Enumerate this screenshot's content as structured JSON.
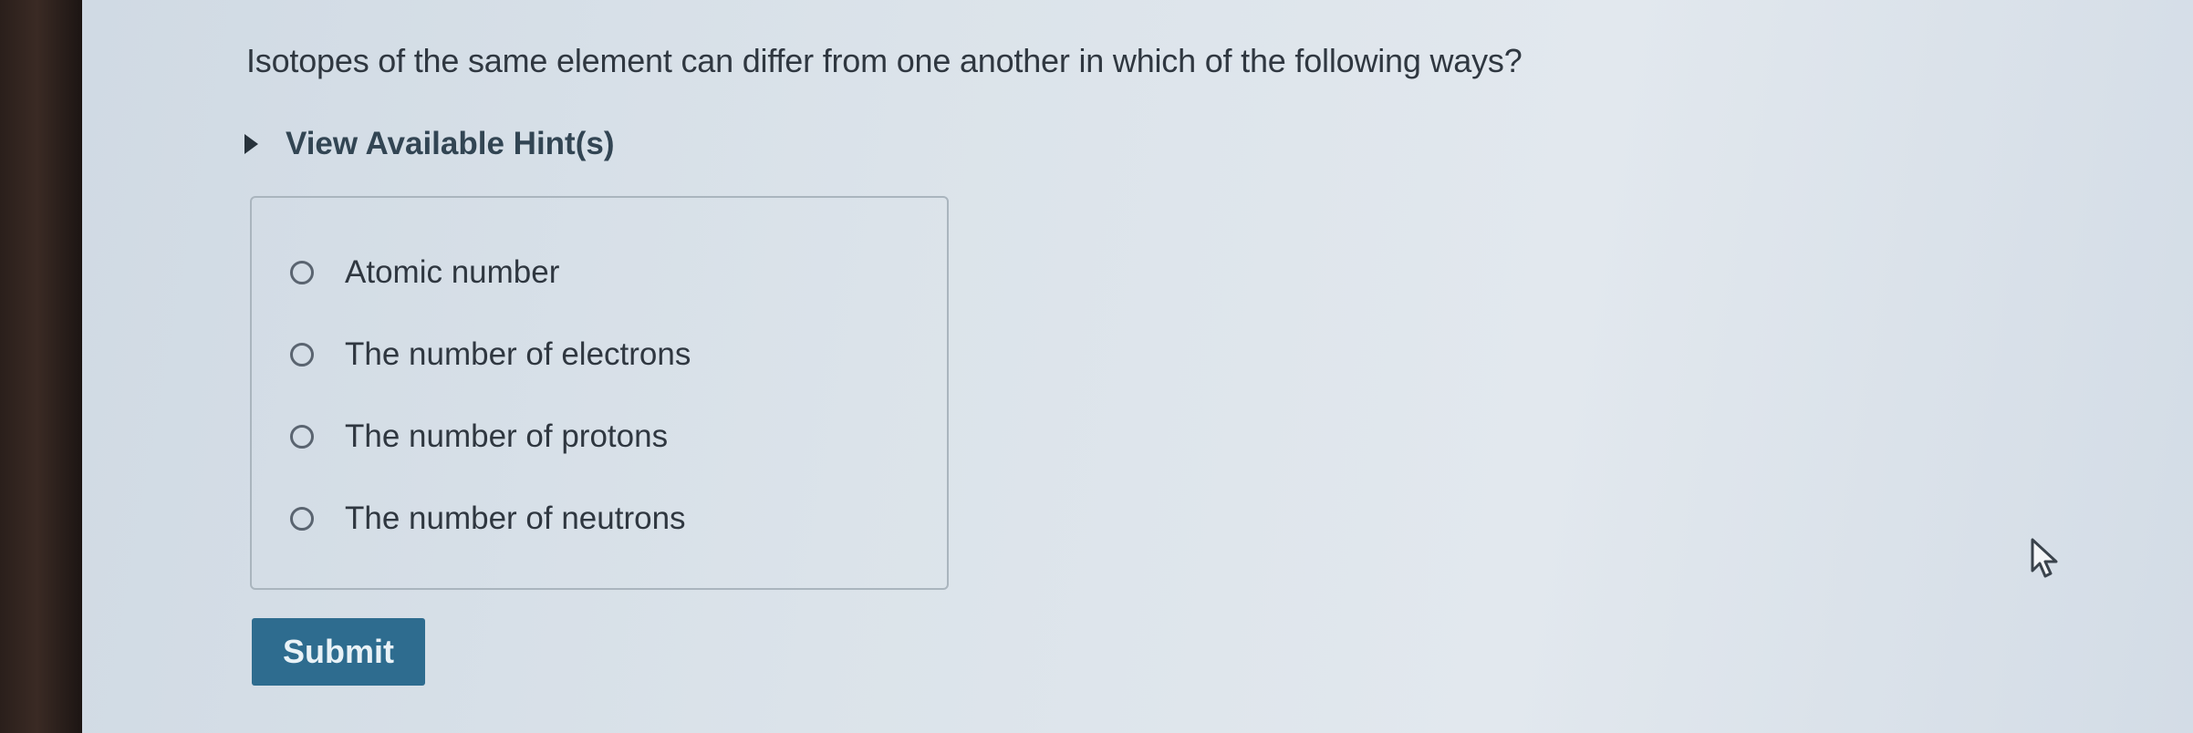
{
  "question": {
    "text": "Isotopes of the same element can differ from one another in which of the following ways?"
  },
  "hint": {
    "label": "View Available Hint(s)",
    "icon": "caret-right-icon"
  },
  "choices": [
    {
      "label": "Atomic number",
      "selected": false
    },
    {
      "label": "The number of electrons",
      "selected": false
    },
    {
      "label": "The number of protons",
      "selected": false
    },
    {
      "label": "The number of neutrons",
      "selected": false
    }
  ],
  "submit": {
    "label": "Submit",
    "color": "#2e6c8f"
  },
  "colors": {
    "text": "#2f3740",
    "hint_text": "#324553",
    "border": "#aab5be"
  }
}
